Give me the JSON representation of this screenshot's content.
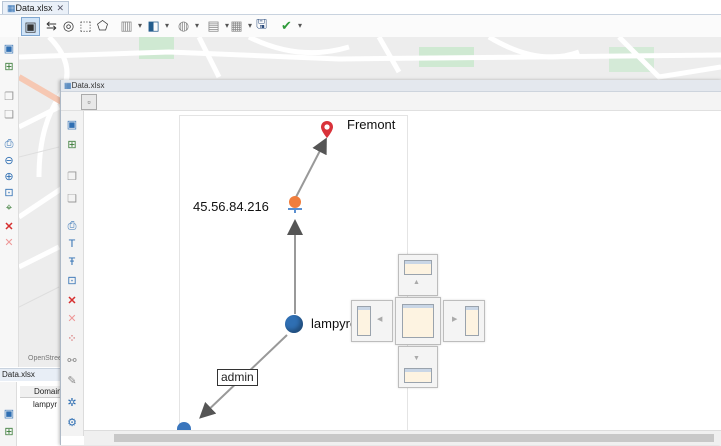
{
  "back_window": {
    "tab_title": "Data.xlsx",
    "tab_close": "✕",
    "map_labels": {
      "attribution": "OpenStreetMap"
    }
  },
  "bottom_pane": {
    "tab_title": "Data.xlsx",
    "column_header": "Domain",
    "cell_value": "lampyr"
  },
  "floating_window": {
    "tab_title": "Data.xlsx"
  },
  "graph": {
    "nodes": [
      {
        "id": "fremont",
        "label": "Fremont",
        "icon": "map-pin-icon",
        "color": "#d9323a"
      },
      {
        "id": "ip",
        "label": "45.56.84.216",
        "icon": "ip-address-icon",
        "color": "#f07d3c"
      },
      {
        "id": "domain",
        "label": "lampyre.io",
        "icon": "domain-globe-icon",
        "color": "#2f6fb3"
      },
      {
        "id": "user",
        "label": "",
        "icon": "user-icon",
        "color": "#3a76bd"
      }
    ],
    "edges": [
      {
        "from": "ip",
        "to": "fremont",
        "label": ""
      },
      {
        "from": "domain",
        "to": "ip",
        "label": ""
      },
      {
        "from": "domain",
        "to": "user",
        "label": "admin"
      }
    ]
  },
  "colors": {
    "accent": "#2f6fb3",
    "map_road": "#ffffff",
    "map_bg": "#eeeeee",
    "pin": "#d9323a"
  }
}
